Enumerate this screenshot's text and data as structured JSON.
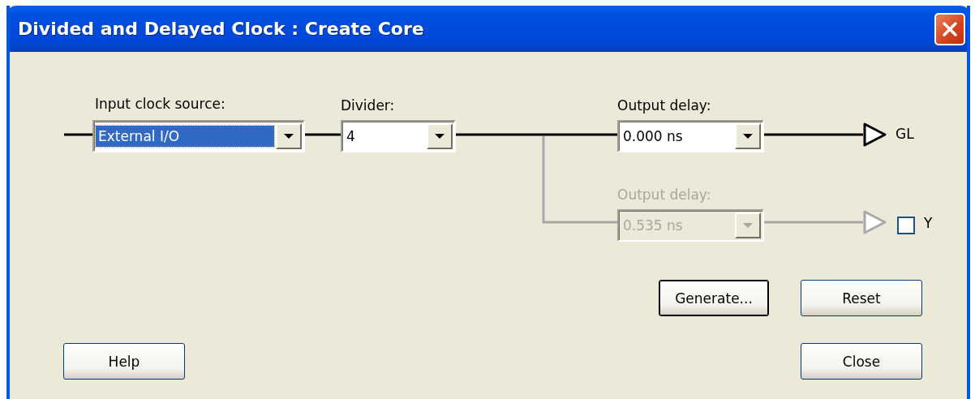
{
  "window": {
    "title": "Divided and Delayed Clock : Create Core"
  },
  "diagram": {
    "input_source": {
      "label": "Input clock source:",
      "value": "External I/O",
      "focused": true
    },
    "divider": {
      "label": "Divider:",
      "value": "4"
    },
    "outputs": [
      {
        "label": "Output delay:",
        "value": "0.000 ns",
        "disabled": false,
        "pin": "GL"
      },
      {
        "label": "Output delay:",
        "value": "0.535 ns",
        "disabled": true,
        "pin": "Y",
        "checked": false
      }
    ]
  },
  "actions": [
    {
      "label": "Generate...",
      "default": true
    },
    {
      "label": "Reset",
      "default": false
    }
  ],
  "footer": {
    "help": "Help",
    "close": "Close"
  }
}
